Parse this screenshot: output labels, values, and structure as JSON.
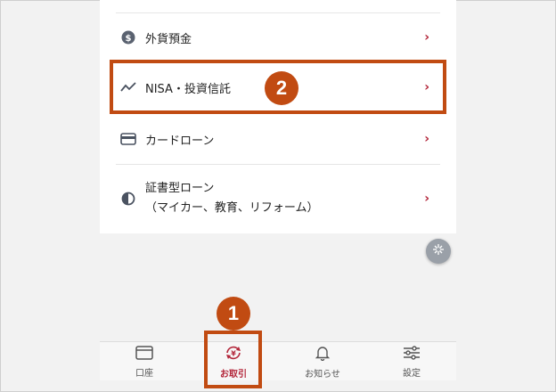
{
  "menu": {
    "items": [
      {
        "label": "外貨預金",
        "icon": "dollar-coin-icon"
      },
      {
        "label": "NISA・投資信託",
        "icon": "trend-line-icon"
      },
      {
        "label": "カードローン",
        "icon": "credit-card-icon"
      },
      {
        "label": "証書型ローン",
        "sublabel": "（マイカー、教育、リフォーム）",
        "icon": "half-circle-icon"
      }
    ]
  },
  "tabbar": {
    "tabs": [
      {
        "label": "口座",
        "icon": "account-card-icon"
      },
      {
        "label": "お取引",
        "icon": "yen-transfer-icon",
        "active": true
      },
      {
        "label": "お知らせ",
        "icon": "bell-icon"
      },
      {
        "label": "設定",
        "icon": "sliders-icon"
      }
    ]
  },
  "annotations": {
    "step1": "1",
    "step2": "2"
  },
  "colors": {
    "accent": "#b3263a",
    "annotation": "#c14b12"
  }
}
